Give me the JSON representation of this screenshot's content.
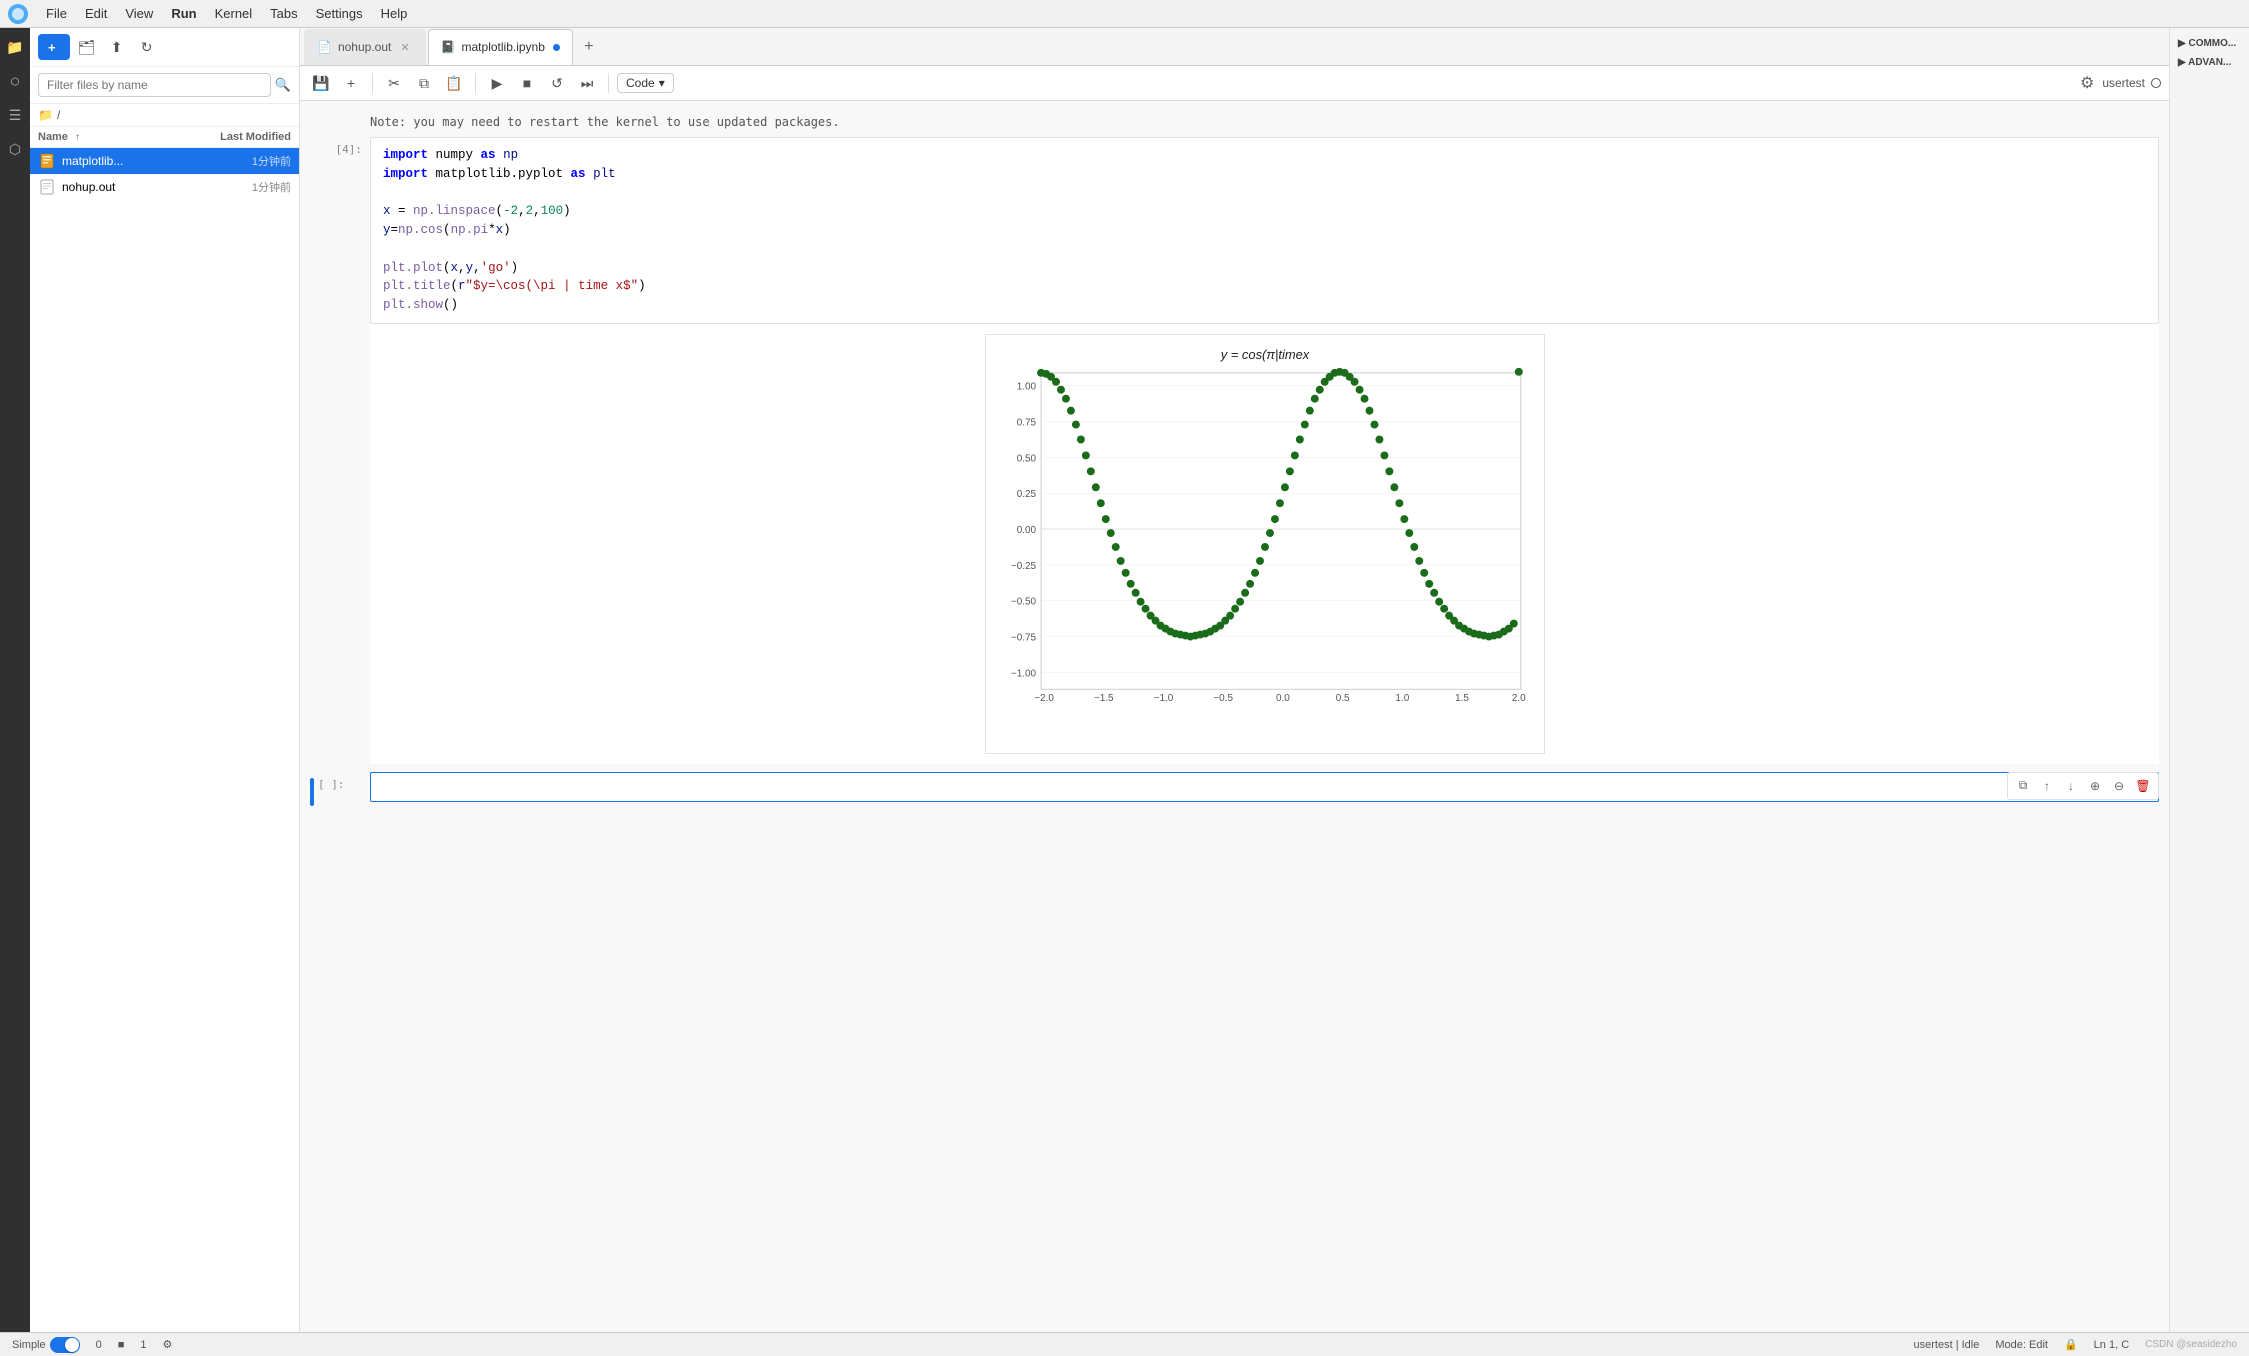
{
  "app": {
    "title": "JupyterLab"
  },
  "menubar": {
    "items": [
      "File",
      "Edit",
      "View",
      "Run",
      "Kernel",
      "Tabs",
      "Settings",
      "Help"
    ],
    "active": "Run"
  },
  "sidebar": {
    "search_placeholder": "Filter files by name",
    "breadcrumb": "/",
    "columns": {
      "name": "Name",
      "name_arrow": "↑",
      "modified": "Last Modified"
    },
    "files": [
      {
        "name": "matplotlib...",
        "full_name": "matplotlib.ipynb",
        "type": "notebook",
        "modified": "1分钟前",
        "selected": true
      },
      {
        "name": "nohup.out",
        "full_name": "nohup.out",
        "type": "text",
        "modified": "1分钟前",
        "selected": false
      }
    ]
  },
  "tabs": [
    {
      "id": "nohup",
      "label": "nohup.out",
      "icon": "📄",
      "active": false,
      "modified": false
    },
    {
      "id": "matplotlib",
      "label": "matplotlib.ipynb",
      "icon": "📓",
      "active": true,
      "modified": true
    }
  ],
  "notebook": {
    "kernel_mode": "Code",
    "user": "usertest",
    "kernel_status": "Idle",
    "mode": "Edit",
    "ln_col": "Ln 1, C",
    "cells": [
      {
        "id": "cell-4",
        "label": "[4]:",
        "type": "code",
        "lines": [
          "import numpy as np",
          "import matplotlib.pyplot as plt",
          "",
          "x = np.linspace(-2,2,100)",
          "y=np.cos(np.pi*x)",
          "",
          "plt.plot(x,y,'go')",
          "plt.title(r\"$y=\\cos(\\pi | time x$\")",
          "plt.show()"
        ],
        "has_output": true,
        "note": "Note: you may need to restart the kernel to use updated packages."
      },
      {
        "id": "cell-empty",
        "label": "[ ]:",
        "type": "code",
        "lines": [],
        "has_output": false
      }
    ],
    "plot": {
      "title": "y = cos(π|timex",
      "x_min": -2.0,
      "x_max": 2.0,
      "y_min": -1.0,
      "y_max": 1.0,
      "x_ticks": [
        -2.0,
        -1.5,
        -1.0,
        -0.5,
        0.0,
        0.5,
        1.0,
        1.5,
        2.0
      ],
      "y_ticks": [
        1.0,
        0.75,
        0.5,
        0.25,
        0.0,
        -0.25,
        -0.5,
        -0.75,
        -1.0
      ],
      "dot_color": "#1a6b1a"
    }
  },
  "right_panel": {
    "sections": [
      "COMMO...",
      "ADVAN..."
    ]
  },
  "status_bar": {
    "mode": "Simple",
    "count": "0",
    "icon1": "■",
    "number": "1",
    "icon2": "⚙",
    "user": "usertest",
    "kernel_status": "Idle",
    "mode_label": "Mode: Edit",
    "shield": "🔒",
    "ln_col": "Ln 1, C",
    "watermark": "CSDN @seasidezho"
  }
}
